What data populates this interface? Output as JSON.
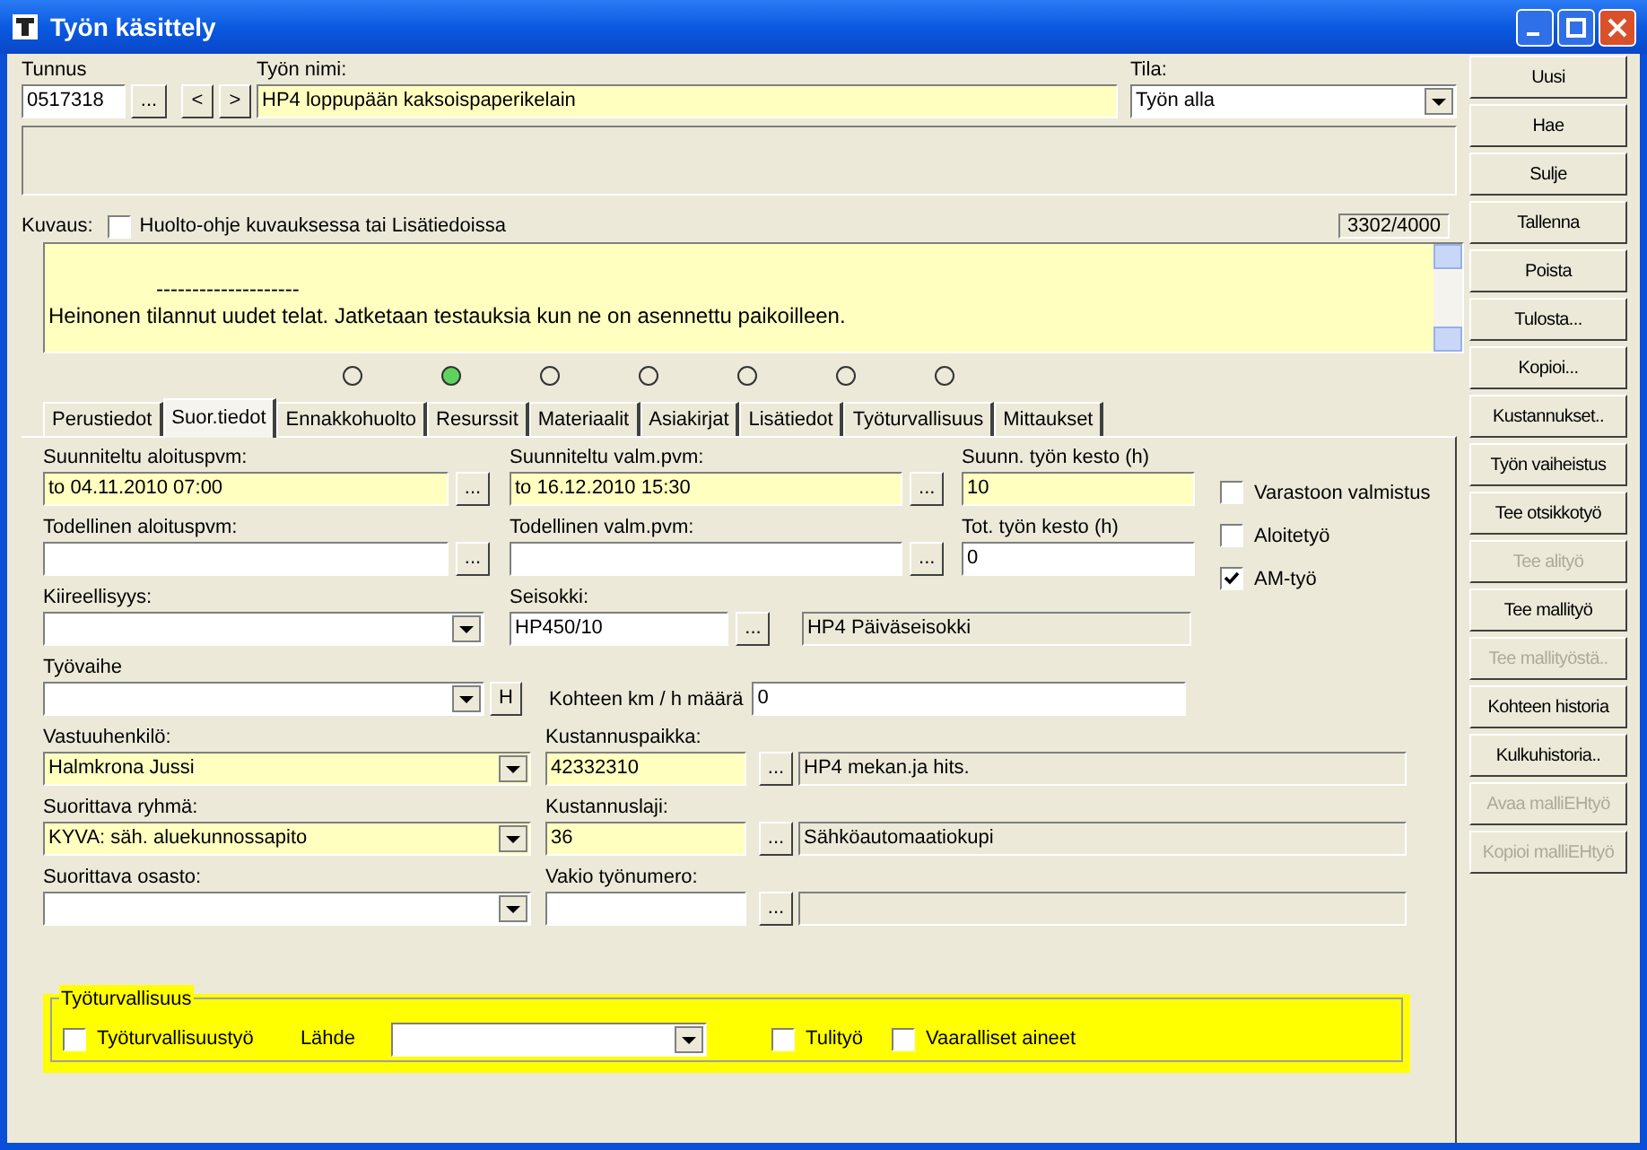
{
  "window": {
    "title": "Työn käsittely"
  },
  "header": {
    "tunnus": {
      "label": "Tunnus",
      "value": "0517318"
    },
    "nav_buttons": [
      "...",
      "<",
      ">"
    ],
    "name": {
      "label": "Työn nimi:",
      "value": "HP4 loppupään kaksoispaperikelain"
    },
    "tila": {
      "label": "Tila:",
      "value": "Työn alla"
    }
  },
  "description": {
    "label": "Kuvaus:",
    "checkbox": {
      "label": "Huolto-ohje kuvauksessa tai Lisätiedoissa",
      "checked": false
    },
    "counter": "3302/4000",
    "lines": [
      "--------------------",
      "Heinonen tilannut uudet telat. Jatketaan testauksia kun ne on asennettu paikoilleen."
    ]
  },
  "steps": [
    {
      "selected": false
    },
    {
      "selected": true
    },
    {
      "selected": false
    },
    {
      "selected": false
    },
    {
      "selected": false
    },
    {
      "selected": false
    },
    {
      "selected": false
    }
  ],
  "tabs": [
    {
      "label": "Perustiedot",
      "selected": false
    },
    {
      "label": "Suor.tiedot",
      "selected": true
    },
    {
      "label": "Ennakkohuolto",
      "selected": false
    },
    {
      "label": "Resurssit",
      "selected": false
    },
    {
      "label": "Materiaalit",
      "selected": false
    },
    {
      "label": "Asiakirjat",
      "selected": false
    },
    {
      "label": "Lisätiedot",
      "selected": false
    },
    {
      "label": "Työturvallisuus",
      "selected": false
    },
    {
      "label": "Mittaukset",
      "selected": false
    }
  ],
  "form": {
    "planned_start": {
      "label": "Suunniteltu aloituspvm:",
      "value": "to 04.11.2010 07:00",
      "required": true
    },
    "planned_end": {
      "label": "Suunniteltu valm.pvm:",
      "value": "to 16.12.2010 15:30",
      "required": true
    },
    "planned_duration": {
      "label": "Suunn. työn kesto (h)",
      "value": "10",
      "required": true
    },
    "actual_start": {
      "label": "Todellinen aloituspvm:",
      "required": false
    },
    "actual_end": {
      "label": "Todellinen valm.pvm:",
      "required": false
    },
    "actual_duration": {
      "label": "Tot. työn kesto (h)",
      "value": "0",
      "required": false
    },
    "urgency": {
      "label": "Kiireellisyys:",
      "required": false
    },
    "shutdown": {
      "label": "Seisokki:",
      "value": "HP450/10",
      "description": "HP4 Päiväseisokki",
      "required": false
    },
    "phase": {
      "label": "Työvaihe",
      "button": "H",
      "required": false
    },
    "km": {
      "label": "Kohteen km / h määrä",
      "value": "0"
    },
    "responsible": {
      "label": "Vastuuhenkilö:",
      "value": "Halmkrona Jussi",
      "required": true
    },
    "cost_center": {
      "label": "Kustannuspaikka:",
      "value": "42332310",
      "description": "HP4 mekan.ja hits.",
      "required": true
    },
    "group": {
      "label": "Suorittava ryhmä:",
      "value": "KYVA: säh. aluekunnossapito",
      "required": true
    },
    "cost_type": {
      "label": "Kustannuslaji:",
      "value": "36",
      "description": "Sähköautomaatiokupi",
      "required": true
    },
    "department": {
      "label": "Suorittava osasto:",
      "required": false
    },
    "std_number": {
      "label": "Vakio työnumero:",
      "required": false
    }
  },
  "lookup_button": "...",
  "options": [
    {
      "label": "Varastoon valmistus",
      "checked": false
    },
    {
      "label": "Aloitetyö",
      "checked": false
    },
    {
      "label": "AM-työ",
      "checked": true
    }
  ],
  "safety": {
    "title": "Työturvallisuus",
    "work": {
      "label": "Työturvallisuustyö",
      "checked": false
    },
    "source": {
      "label": "Lähde"
    },
    "fire": {
      "label": "Tulityö",
      "checked": false
    },
    "hazard": {
      "label": "Vaaralliset aineet",
      "checked": false
    }
  },
  "actions": [
    {
      "label": "Uusi",
      "disabled": false
    },
    {
      "label": "Hae",
      "disabled": false
    },
    {
      "label": "Sulje",
      "disabled": false
    },
    {
      "label": "Tallenna",
      "disabled": false
    },
    {
      "label": "Poista",
      "disabled": false
    },
    {
      "label": "Tulosta...",
      "disabled": false
    },
    {
      "label": "Kopioi...",
      "disabled": false
    },
    {
      "label": "Kustannukset..",
      "disabled": false
    },
    {
      "label": "Työn vaiheistus",
      "disabled": false
    },
    {
      "label": "Tee otsikkotyö",
      "disabled": false
    },
    {
      "label": "Tee alityö",
      "disabled": true
    },
    {
      "label": "Tee mallityö",
      "disabled": false
    },
    {
      "label": "Tee mallityöstä..",
      "disabled": true
    },
    {
      "label": "Kohteen historia",
      "disabled": false
    },
    {
      "label": "Kulkuhistoria..",
      "disabled": false
    },
    {
      "label": "Avaa malliEHtyö",
      "disabled": true
    },
    {
      "label": "Kopioi malliEHtyö",
      "disabled": true
    }
  ]
}
